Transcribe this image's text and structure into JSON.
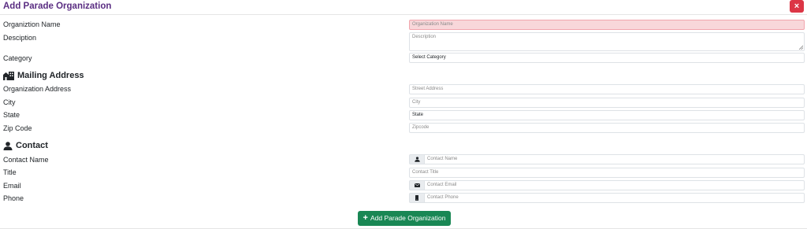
{
  "modal": {
    "title": "Add Parade Organization",
    "close_label": "×"
  },
  "fields": {
    "org_name": {
      "label": "Organiztion Name",
      "placeholder": "Organization Name"
    },
    "description": {
      "label": "Desciption",
      "placeholder": "Description"
    },
    "category": {
      "label": "Category",
      "selected": "Select Category"
    }
  },
  "mailing": {
    "heading": "Mailing Address",
    "icon": "building-icon",
    "address": {
      "label": "Organization Address",
      "placeholder": "Street Address"
    },
    "city": {
      "label": "City",
      "placeholder": "City"
    },
    "state": {
      "label": "State",
      "selected": "State"
    },
    "zip": {
      "label": "Zip Code",
      "placeholder": "Zipcode"
    }
  },
  "contact": {
    "heading": "Contact",
    "icon": "user-icon",
    "name": {
      "label": "Contact Name",
      "placeholder": "Contact Name",
      "icon": "user-icon"
    },
    "title": {
      "label": "Title",
      "placeholder": "Contact Title"
    },
    "email": {
      "label": "Email",
      "placeholder": "Contact Email",
      "icon": "envelope-icon"
    },
    "phone": {
      "label": "Phone",
      "placeholder": "Contact Phone",
      "icon": "phone-icon"
    }
  },
  "submit": {
    "label": "Add Parade Organization",
    "icon": "plus-icon"
  },
  "colors": {
    "title": "#5a2d82",
    "close": "#dc3545",
    "submit": "#198754",
    "invalid_bg": "#f8d7da"
  }
}
